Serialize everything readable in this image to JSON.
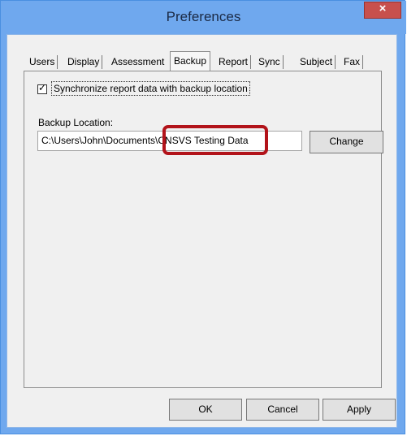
{
  "window": {
    "title": "Preferences",
    "close_glyph": "×"
  },
  "tabs": [
    {
      "label": "Users"
    },
    {
      "label": "Display"
    },
    {
      "label": "Assessment"
    },
    {
      "label": "Backup",
      "active": true
    },
    {
      "label": "Report"
    },
    {
      "label": "Sync"
    },
    {
      "label": "Subject"
    },
    {
      "label": "Fax"
    }
  ],
  "backup": {
    "sync_checkbox_label": "Synchronize report data with backup location",
    "sync_checked": true,
    "check_glyph": "✓",
    "location_label": "Backup Location:",
    "location_value": "C:\\Users\\John\\Documents\\CNSVS Testing Data",
    "change_label": "Change"
  },
  "footer": {
    "ok_label": "OK",
    "cancel_label": "Cancel",
    "apply_label": "Apply"
  },
  "colors": {
    "titlebar": "#6fa8ee",
    "close_button": "#c7504d",
    "highlight": "#b2131a"
  }
}
